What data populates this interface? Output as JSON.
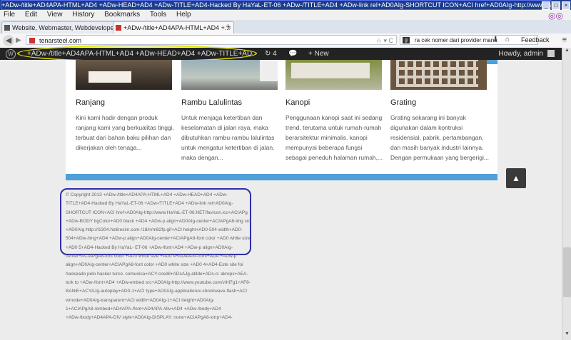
{
  "window": {
    "title": "+ADw-/title+AD4APA-HTML+AD4 +ADw-HEAD+AD4 +ADw-TITLE+AD4-Hacked By HaYaL-ET-06 +ADw-/TITLE+AD4 +ADw-link rel+AD0AIg-SHORTCUT ICON+ACI href+AD0AIg-http://www.HaYaL-ET- 06.NET/favicon.ico+..."
  },
  "menu": [
    "File",
    "Edit",
    "View",
    "History",
    "Bookmarks",
    "Tools",
    "Help"
  ],
  "tabs": [
    {
      "label": "Website, Webmaster, Webdeveloper |...",
      "active": false
    },
    {
      "label": "+ADw-/title+AD4APA-HTML+AD4 +...",
      "active": true
    }
  ],
  "nav": {
    "url": "tenarsteel.com",
    "search_value": "ra cek nomer dari provider mana",
    "feedback": "Feedback"
  },
  "wpbar": {
    "site_name": "+ADw-/title+AD4APA-HTML+AD4 +ADw-HEAD+AD4 +ADw-TITLE+AD4-Hacked By H",
    "updates": "4",
    "new_label": "+ New",
    "howdy": "Howdy, admin"
  },
  "products": [
    {
      "title": "Ranjang",
      "text": "Kini kami hadir dengan produk ranjang kami yang berkualitas tinggi, terbuat dari bahan baku pilihan dan dikerjakan oleh tenaga..."
    },
    {
      "title": "Rambu Lalulintas",
      "text": "Untuk menjaga ketertiban dan keselamatan di jalan raya, maka dibutuhkan rambu-rambu lalulintas untuk mengatur ketertiban di jalan. maka dengan..."
    },
    {
      "title": "Kanopi",
      "text": "Penggunaan kanopi saat ini sedang trend, terutama untuk rumah-rumah berarsitektur minimalis. kanopi mempunyai beberapa fungsi sebagai peneduh halaman rumah,..."
    },
    {
      "title": "Grating",
      "text": "Grating sekarang ini banyak digunakan dalam kontruksi residensial, pabrik, pertambangan, dan masih banyak industri lainnya. Dengan permukaan yang bergerigi..."
    }
  ],
  "footer": {
    "copyright": "© Copyright 2013 +ADw-/title+AD4APA-HTML+AD4 +ADw-HEAD+AD4 +ADw-TITLE+AD4-Hacked By HaYaL-ET-06 +ADw-/TITLE+AD4 +ADw-link rel+AD0AIg-SHORTCUT ICON+ACI href+AD0AIg-http://www.HaYaL-ET-06.NET/favicon.ico+ACIAPg +ADw-BODY bgColor+AD0 black +AD4 +ADw-p align+AD0AIg-center+ACIAPgA8-img src +AD0AIg-http://i1304.hizliresim.com /18/n/m82fp.gif+ACI height+AD0-504 width+AD0-504+ADw-/img+AD4 +ADw-p align+AD0AIg-center+ACIAPgA8-font color +AD0 white size +AD0 5+AD4-Hacked By HaYaL- ET-06 +ADw-/font+AD4 +ADw-p align+AD0AIg-center+ACIAPgA8-font color +AD0 white size +AD0 4+AD4APA-/font+AD4 +ADw-p align+AD0AIg-center+ACIAPgA8-font color +AD0 white size +AD0 4+AD4-Este site foi hackeado pelo hacker turco. comunica+ACY-ccedil+ADsAJg-atilde+ADs-o: akrepx+AEA-turk to +ADw-/font+AD4 +ADw-embed src+AD0AIg-http://www.youtube.com/v/hf7g1+AF8-BANiE+ACYAJg-autoplay+AD0-1+ACI type+AD0AIg-application/x-shockwave-flash+ACI wmode+AD0AIg-transparent+ACI width+AD0AIg-1+ACI height+AD0AIg-1+ACIAPgA8-/embed+AD4APA-/font+AD4APA-/div+AD4 +ADw-/body+AD4 +ADw-/body+AD4APA-DIV style+AD0AIg-DISPLAY: none+ACIAPgA8-xmp+AD4-"
  }
}
